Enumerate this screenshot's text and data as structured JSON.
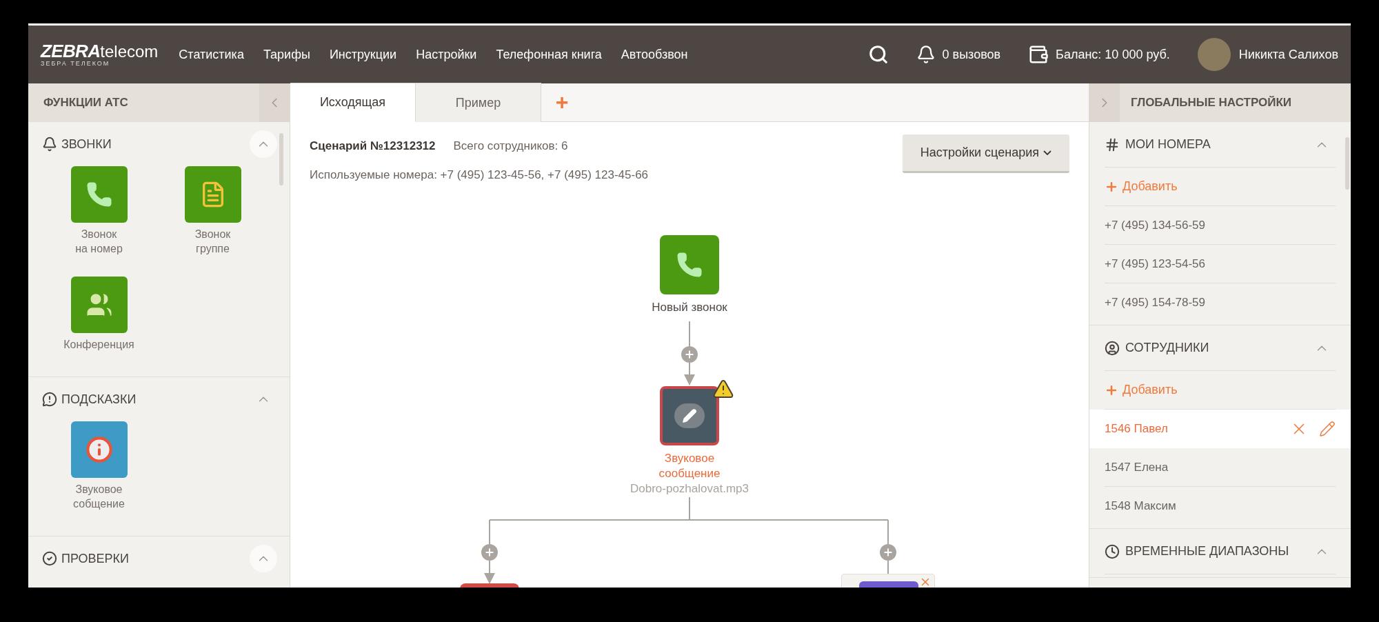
{
  "header": {
    "logo": {
      "brand": "ZEBRA",
      "suffix": "telecom",
      "tagline": "ЗЕБРА ТЕЛЕКОМ"
    },
    "nav": [
      "Статистика",
      "Тарифы",
      "Инструкции",
      "Настройки",
      "Телефонная книга",
      "Автообзвон"
    ],
    "calls": "0 вызовов",
    "balance": "Баланс: 10 000 руб.",
    "user": "Никикта Салихов"
  },
  "left_panel": {
    "title": "ФУНКЦИИ АТС",
    "sections": [
      {
        "kind": "calls",
        "title": "ЗВОНКИ",
        "expanded": true,
        "items": [
          {
            "kind": "call",
            "label": "Звонок\nна номер"
          },
          {
            "kind": "group",
            "label": "Звонок\nгруппе"
          },
          {
            "kind": "conference",
            "label": "Конференция"
          }
        ]
      },
      {
        "kind": "hints",
        "title": "ПОДСКАЗКИ",
        "expanded": true,
        "items": [
          {
            "kind": "message",
            "label": "Звуковое\nсобщение"
          }
        ]
      },
      {
        "kind": "checks",
        "title": "ПРОВЕРКИ",
        "expanded": true
      }
    ]
  },
  "tabs": [
    {
      "label": "Исходящая",
      "selected": true
    },
    {
      "label": "Пример",
      "selected": false
    }
  ],
  "add_tab": "+",
  "scenario": {
    "title": "Сценарий №12312312",
    "staff": "Всего сотрудников: 6",
    "numbers": "Используемые номера: +7 (495) 123-45-56, +7 (495) 123-45-66",
    "settings_button": "Настройки сценария"
  },
  "flow": {
    "nodes": [
      {
        "kind": "call",
        "label": "Новый звонок",
        "warning": false,
        "error": false
      },
      {
        "kind": "message",
        "label": "Звуковое\nсообщение",
        "file": "Dobro-pozhalovat.mp3",
        "warning": true,
        "error": true
      }
    ],
    "branches": [
      {
        "color": "#d24b45",
        "removable": false
      },
      {
        "color": "#6f5bd0",
        "removable": true
      }
    ]
  },
  "right_panel": {
    "title": "ГЛОБАЛЬНЫЕ НАСТРОЙКИ",
    "sections": [
      {
        "kind": "numbers",
        "title": "МОИ НОМЕРА",
        "expanded": true,
        "add": "Добавить",
        "items": [
          {
            "label": "+7 (495) 134-56-59",
            "selected": false
          },
          {
            "label": "+7 (495) 123-54-56",
            "selected": false
          },
          {
            "label": "+7 (495) 154-78-59",
            "selected": false
          }
        ]
      },
      {
        "kind": "staff",
        "title": "СОТРУДНИКИ",
        "expanded": true,
        "add": "Добавить",
        "items": [
          {
            "label": "1546 Павел",
            "selected": true
          },
          {
            "label": "1547 Елена",
            "selected": false
          },
          {
            "label": "1548 Максим",
            "selected": false
          }
        ]
      },
      {
        "kind": "time",
        "title": "ВРЕМЕННЫЕ ДИАПАЗОНЫ",
        "expanded": true
      }
    ]
  }
}
